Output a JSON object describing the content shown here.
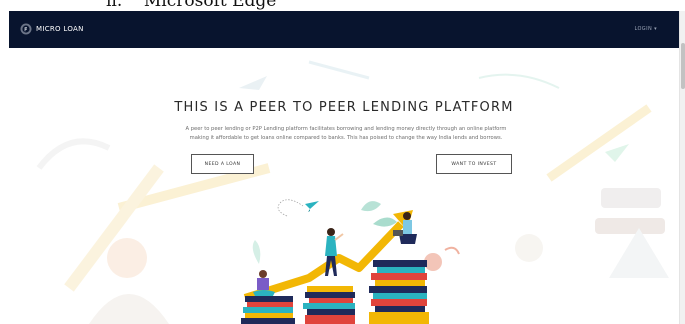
{
  "doc_fragment": "ii.    Microsoft Edge",
  "navbar": {
    "brand": "MICRO LOAN",
    "login_menu": "LOGIN ▾"
  },
  "hero": {
    "title": "THIS IS A PEER TO PEER LENDING PLATFORM",
    "subtitle_line1": "A peer to peer lending or P2P Lending platform facilitates borrowing and lending money directly through an online platform",
    "subtitle_line2": "making it affordable to get loans online compared to banks. This has poised to change the way India lends and borrows.",
    "need_loan_button": "NEED A LOAN",
    "invest_button": "WANT TO INVEST"
  },
  "colors": {
    "navbar_bg": "#08142e",
    "accent_yellow": "#f2b705",
    "accent_teal": "#2bb3c0",
    "book_red": "#e0443c",
    "book_navy": "#1f2a5a"
  },
  "icons": {
    "brand_logo": "coin-logo-icon",
    "paper_plane": "paper-plane-icon"
  }
}
